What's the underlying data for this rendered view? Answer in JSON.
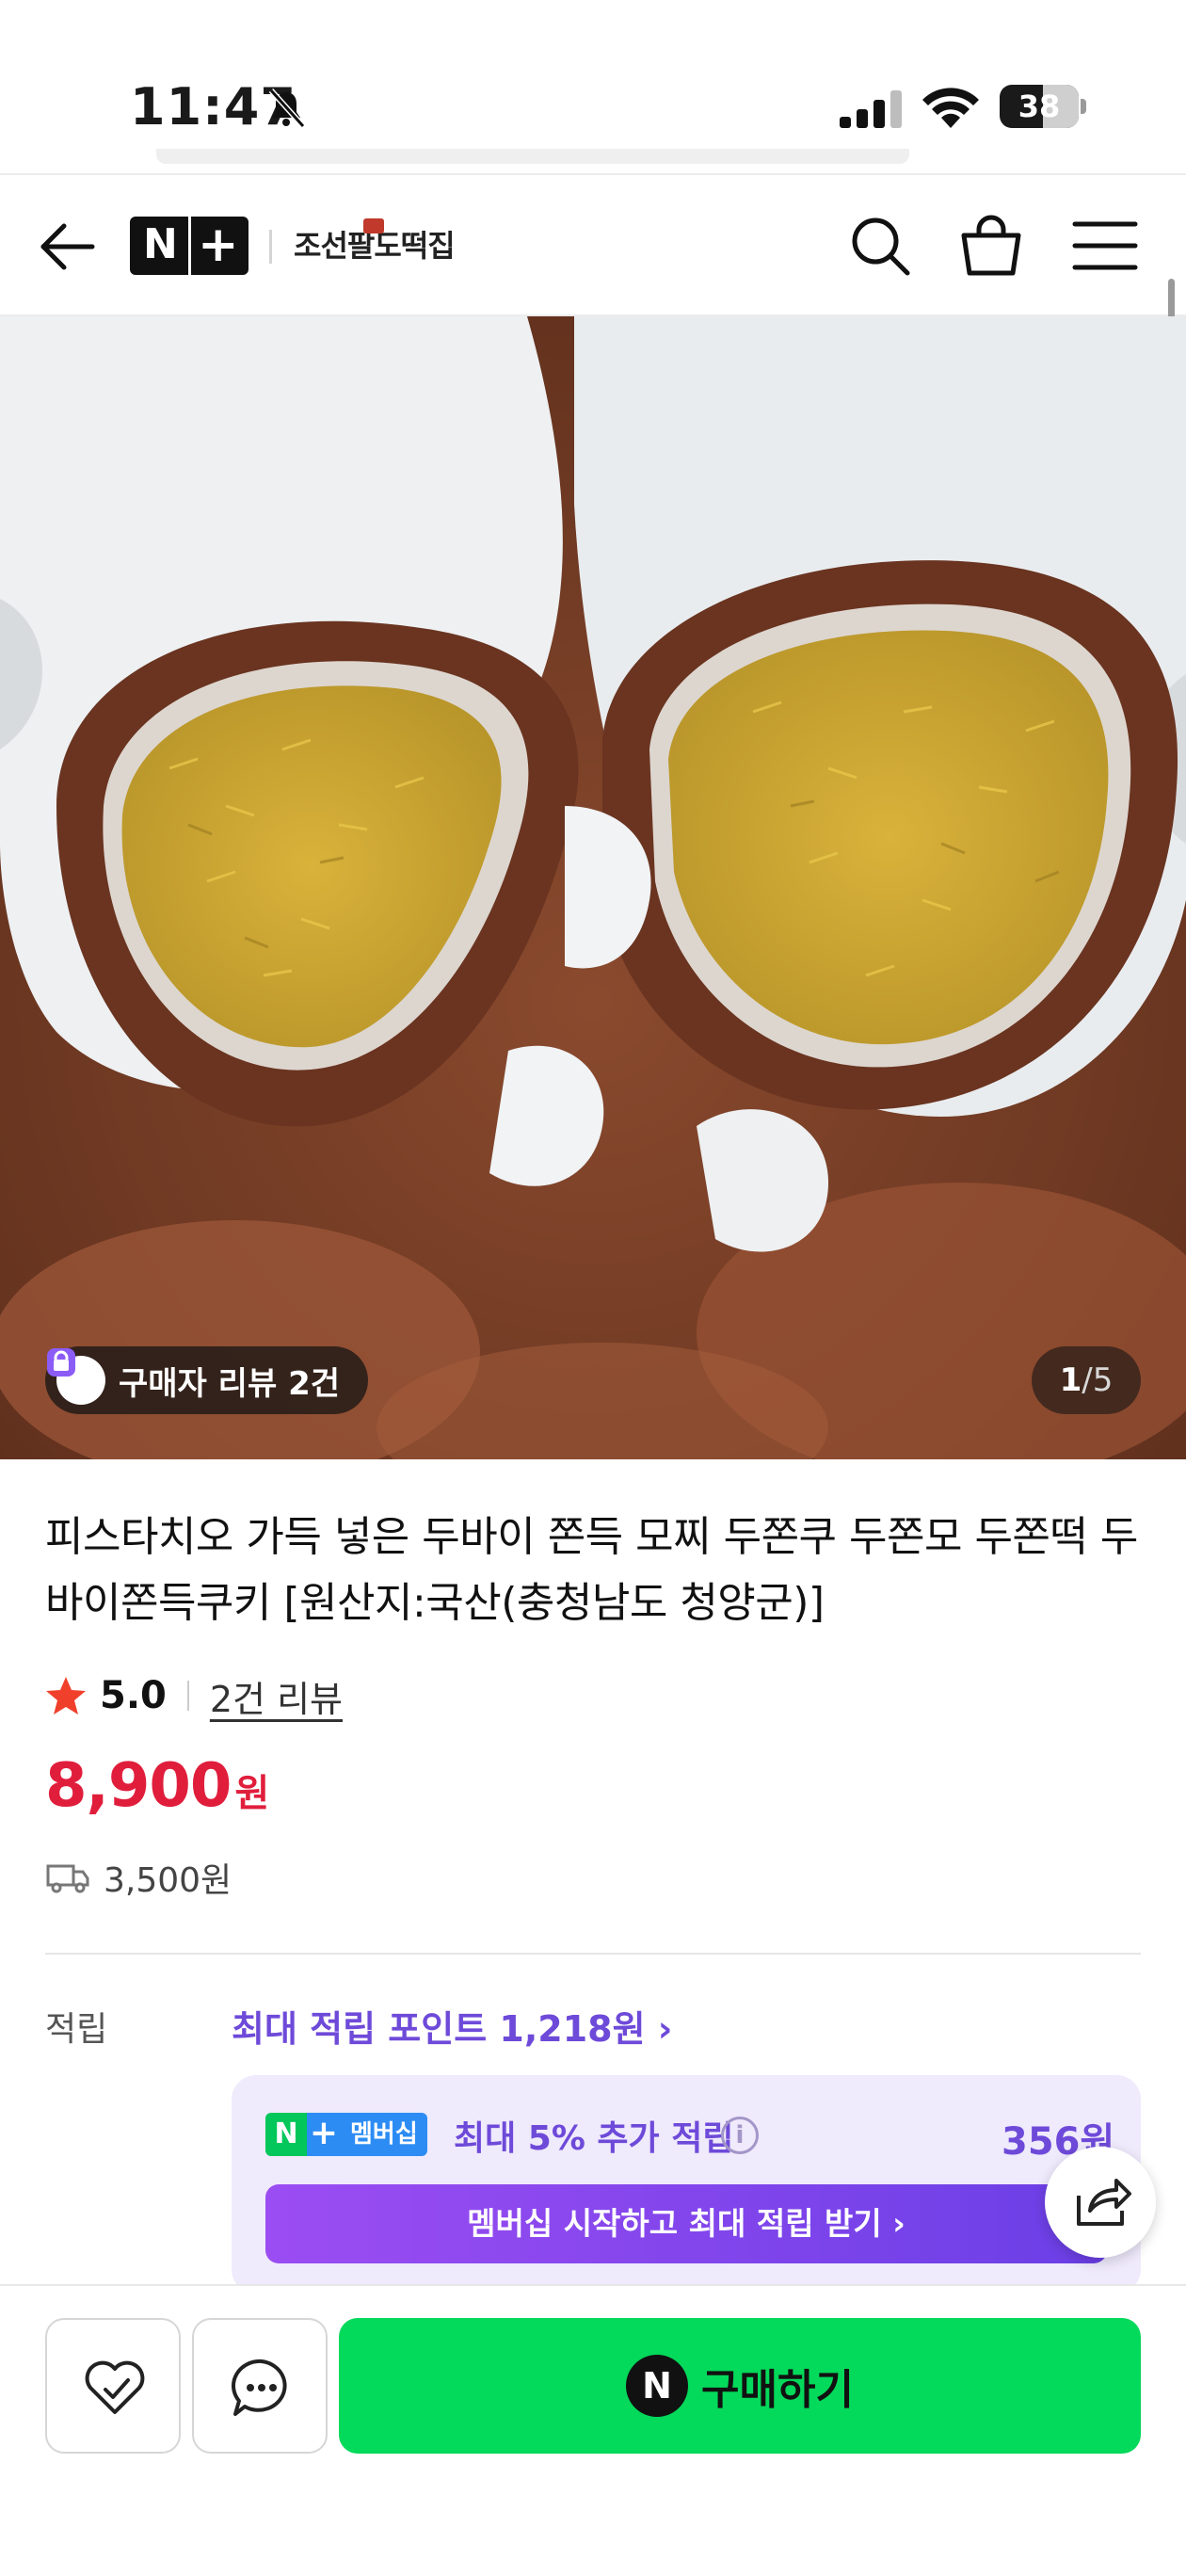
{
  "status_bar": {
    "time": "11:47",
    "battery": "38"
  },
  "header": {
    "store_name": "조선팔도떡집",
    "icons": [
      "back-arrow-icon",
      "nplus-logo",
      "search-icon",
      "shopping-bag-icon",
      "menu-icon"
    ]
  },
  "gallery": {
    "review_badge": "구매자 리뷰 2건",
    "current_page": "1",
    "page_separator": "/",
    "total_pages": "5"
  },
  "product": {
    "title": "피스타치오 가득 넣은 두바이 쫀득 모찌 두쫀쿠 두쫀모 두쫀떡 두바이쫀득쿠키 [원산지:국산(충청남도 청양군)]",
    "rating": "5.0",
    "review_link": "2건 리뷰",
    "price": "8,900",
    "price_unit": "원",
    "shipping_fee": "3,500원"
  },
  "points": {
    "label": "적립",
    "max_points": "최대 적립 포인트 1,218원 ›",
    "membership_badge_n": "N",
    "membership_badge_plus": "+",
    "membership_badge_label": "멤버십",
    "membership_text": "최대 5% 추가 적립",
    "info": "i",
    "membership_amount": "356원",
    "cta": "멤버십 시작하고 최대 적립 받기 ›"
  },
  "bottom_bar": {
    "buy_icon": "N",
    "buy_label": "구매하기"
  },
  "colors": {
    "price_red": "#e01e3c",
    "points_purple": "#6e4ad9",
    "buy_green": "#03d95a",
    "membership_bg": "#efeafc"
  }
}
